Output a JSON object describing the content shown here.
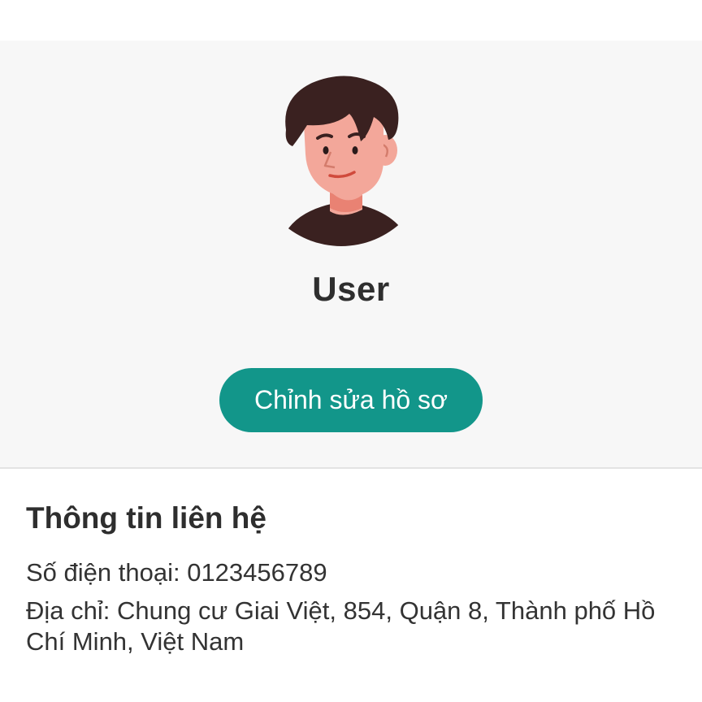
{
  "profile": {
    "name": "User",
    "avatar_icon": "user-avatar-illustration",
    "edit_button_label": "Chỉnh sửa hồ sơ"
  },
  "contact": {
    "title": "Thông tin liên hệ",
    "phone": "Số điện thoại: 0123456789",
    "address": "Địa chỉ: Chung cư Giai Việt, 854, Quận 8, Thành phố Hồ Chí Minh, Việt Nam"
  },
  "colors": {
    "accent": "#12968a",
    "header_bg": "#f7f7f7",
    "text": "#2e2e2e"
  }
}
